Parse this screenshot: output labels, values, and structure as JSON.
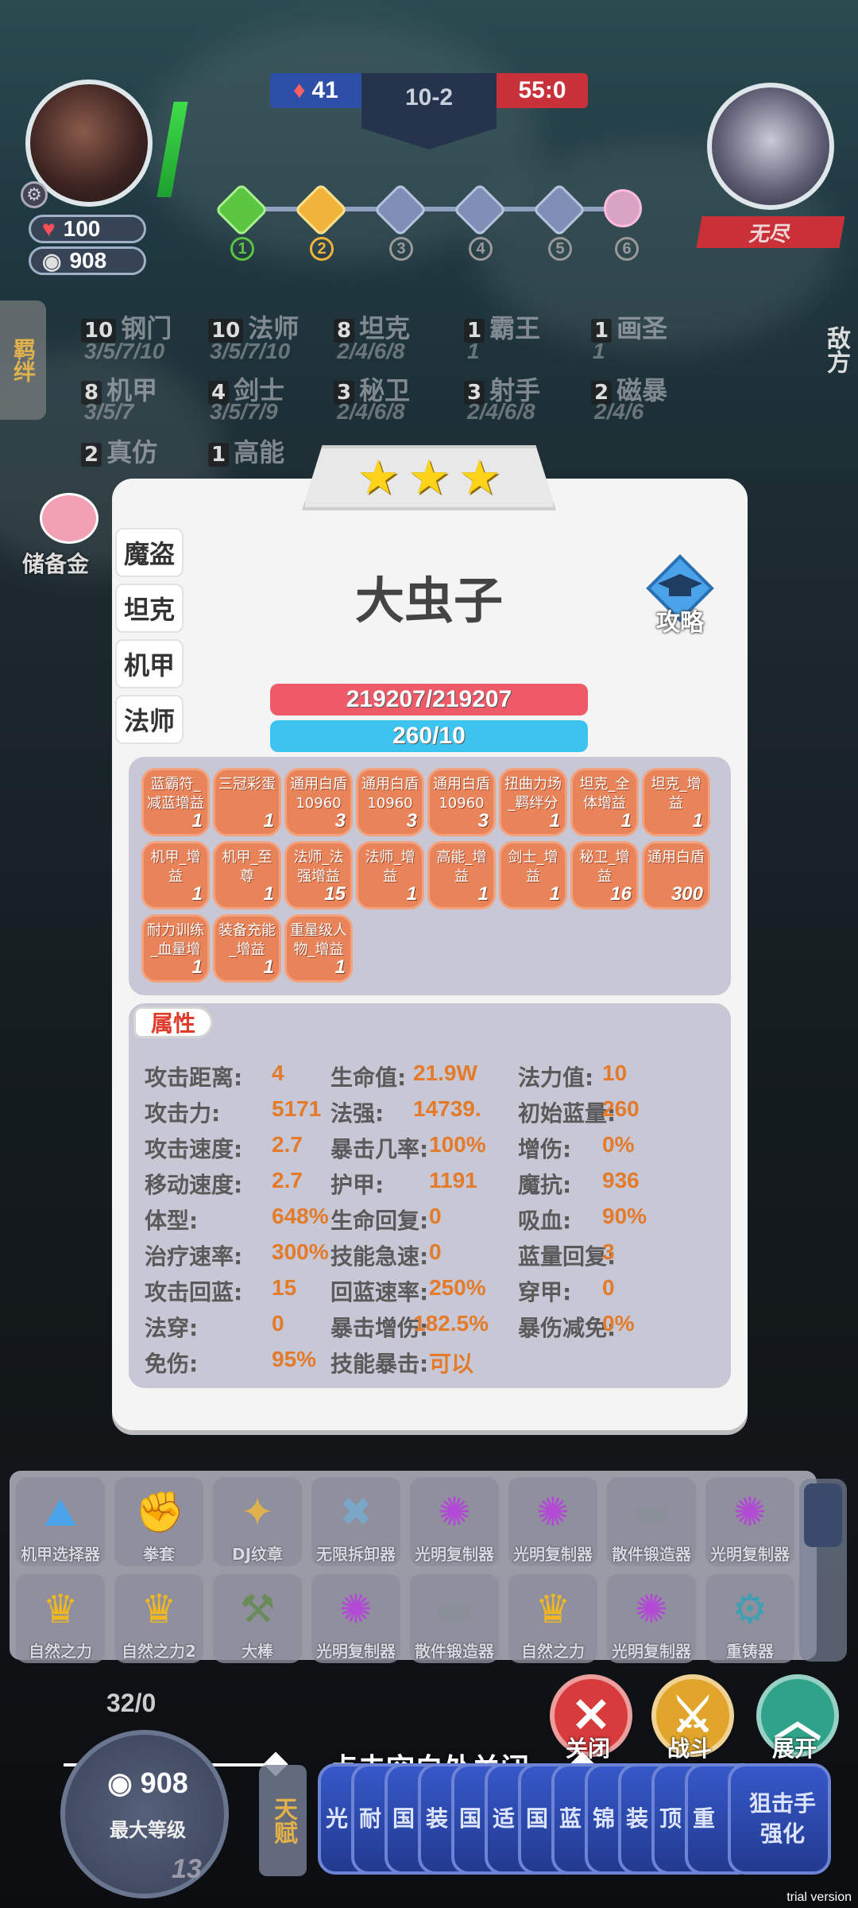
{
  "hud": {
    "left_score": "41",
    "stage": "10-2",
    "right_score": "55:0",
    "hp": "100",
    "gold": "908",
    "endless_label": "无尽",
    "stage_nodes": [
      "1",
      "2",
      "3",
      "4",
      "5",
      "6"
    ]
  },
  "traits": [
    {
      "name": "钢门",
      "count": "10",
      "levels": "3/5/7/10"
    },
    {
      "name": "法师",
      "count": "10",
      "levels": "3/5/7/10"
    },
    {
      "name": "坦克",
      "count": "8",
      "levels": "2/4/6/8"
    },
    {
      "name": "霸王",
      "count": "1",
      "levels": "1"
    },
    {
      "name": "画圣",
      "count": "1",
      "levels": "1"
    },
    {
      "name": "机甲",
      "count": "8",
      "levels": "3/5/7"
    },
    {
      "name": "剑士",
      "count": "4",
      "levels": "3/5/7/9"
    },
    {
      "name": "秘卫",
      "count": "3",
      "levels": "2/4/6/8"
    },
    {
      "name": "射手",
      "count": "3",
      "levels": "2/4/6/8"
    },
    {
      "name": "磁暴",
      "count": "2",
      "levels": "2/4/6"
    },
    {
      "name": "真仿",
      "count": "2",
      "levels": ""
    },
    {
      "name": "高能",
      "count": "1",
      "levels": ""
    }
  ],
  "side_tab": "羁绊",
  "enemy_label": "敌方",
  "reserve_label": "储备金",
  "modal": {
    "stars": 3,
    "unit_name": "大虫子",
    "guide_label": "攻略",
    "class_tabs": [
      "魔盗",
      "坦克",
      "机甲",
      "法师"
    ],
    "hp_text": "219207/219207",
    "mana_text": "260/10",
    "buffs": [
      {
        "name": "蓝霸符_减蓝增益",
        "count": "1"
      },
      {
        "name": "三冠彩蛋",
        "count": "1"
      },
      {
        "name": "通用白盾10960",
        "count": "3"
      },
      {
        "name": "通用白盾10960",
        "count": "3"
      },
      {
        "name": "通用白盾10960",
        "count": "3"
      },
      {
        "name": "扭曲力场_羁绊分",
        "count": "1"
      },
      {
        "name": "坦克_全体增益",
        "count": "1"
      },
      {
        "name": "坦克_增益",
        "count": "1"
      },
      {
        "name": "机甲_增益",
        "count": "1"
      },
      {
        "name": "机甲_至尊",
        "count": "1"
      },
      {
        "name": "法师_法强增益",
        "count": "15"
      },
      {
        "name": "法师_增益",
        "count": "1"
      },
      {
        "name": "高能_增益",
        "count": "1"
      },
      {
        "name": "剑士_增益",
        "count": "1"
      },
      {
        "name": "秘卫_增益",
        "count": "16"
      },
      {
        "name": "通用白盾",
        "count": "300"
      },
      {
        "name": "耐力训练_血量增",
        "count": "1"
      },
      {
        "name": "装备充能_增益",
        "count": "1"
      },
      {
        "name": "重量级人物_增益",
        "count": "1"
      }
    ],
    "attr_title": "属性",
    "attrs": [
      {
        "label": "攻击距离:",
        "value": "4"
      },
      {
        "label": "生命值:",
        "value": "21.9W"
      },
      {
        "label": "法力值:",
        "value": "10"
      },
      {
        "label": "攻击力:",
        "value": "5171"
      },
      {
        "label": "法强:",
        "value": "14739."
      },
      {
        "label": "初始蓝量:",
        "value": "260"
      },
      {
        "label": "攻击速度:",
        "value": "2.7"
      },
      {
        "label": "暴击几率:",
        "value": "100%"
      },
      {
        "label": "增伤:",
        "value": "0%"
      },
      {
        "label": "移动速度:",
        "value": "2.7"
      },
      {
        "label": "护甲:",
        "value": "1191"
      },
      {
        "label": "魔抗:",
        "value": "936"
      },
      {
        "label": "体型:",
        "value": "648%"
      },
      {
        "label": "生命回复:",
        "value": "0"
      },
      {
        "label": "吸血:",
        "value": "90%"
      },
      {
        "label": "治疗速率:",
        "value": "300%"
      },
      {
        "label": "技能急速:",
        "value": "0"
      },
      {
        "label": "蓝量回复:",
        "value": "3"
      },
      {
        "label": "攻击回蓝:",
        "value": "15"
      },
      {
        "label": "回蓝速率:",
        "value": "250%"
      },
      {
        "label": "穿甲:",
        "value": "0"
      },
      {
        "label": "法穿:",
        "value": "0"
      },
      {
        "label": "暴击增伤:",
        "value": "182.5%"
      },
      {
        "label": "暴伤减免:",
        "value": "0%"
      },
      {
        "label": "免伤:",
        "value": "95%"
      },
      {
        "label": "技能暴击:",
        "value": "可以"
      }
    ]
  },
  "inventory": [
    {
      "label": "机甲选择器",
      "icon": "mech-icon"
    },
    {
      "label": "拳套",
      "icon": "glove-icon"
    },
    {
      "label": "DJ纹章",
      "icon": "emblem-icon"
    },
    {
      "label": "无限拆卸器",
      "icon": "tools-icon"
    },
    {
      "label": "光明复制器",
      "icon": "orb-icon"
    },
    {
      "label": "光明复制器",
      "icon": "orb-icon"
    },
    {
      "label": "散件锻造器",
      "icon": "anvil-icon"
    },
    {
      "label": "光明复制器",
      "icon": "orb-icon"
    },
    {
      "label": "自然之力",
      "icon": "crown-icon"
    },
    {
      "label": "自然之力2",
      "icon": "crown-icon"
    },
    {
      "label": "大棒",
      "icon": "club-icon"
    },
    {
      "label": "光明复制器",
      "icon": "orb-icon"
    },
    {
      "label": "散件锻造器",
      "icon": "anvil-icon"
    },
    {
      "label": "自然之力",
      "icon": "crown-icon"
    },
    {
      "label": "光明复制器",
      "icon": "orb-icon"
    },
    {
      "label": "重铸器",
      "icon": "gear-icon"
    }
  ],
  "bottom": {
    "close_hint": "点击空白处关闭",
    "close_label": "关闭",
    "battle_label": "战斗",
    "expand_label": "展开",
    "capacity": "32/0",
    "gold": "908",
    "max_level_label": "最大等级",
    "level": "13",
    "talent_label": "天赋",
    "cards": [
      "光",
      "耐",
      "国",
      "装",
      "国",
      "适",
      "国",
      "蓝",
      "锦",
      "装",
      "顶",
      "重"
    ],
    "last_card": "狙击手强化"
  },
  "trial": "trial version"
}
